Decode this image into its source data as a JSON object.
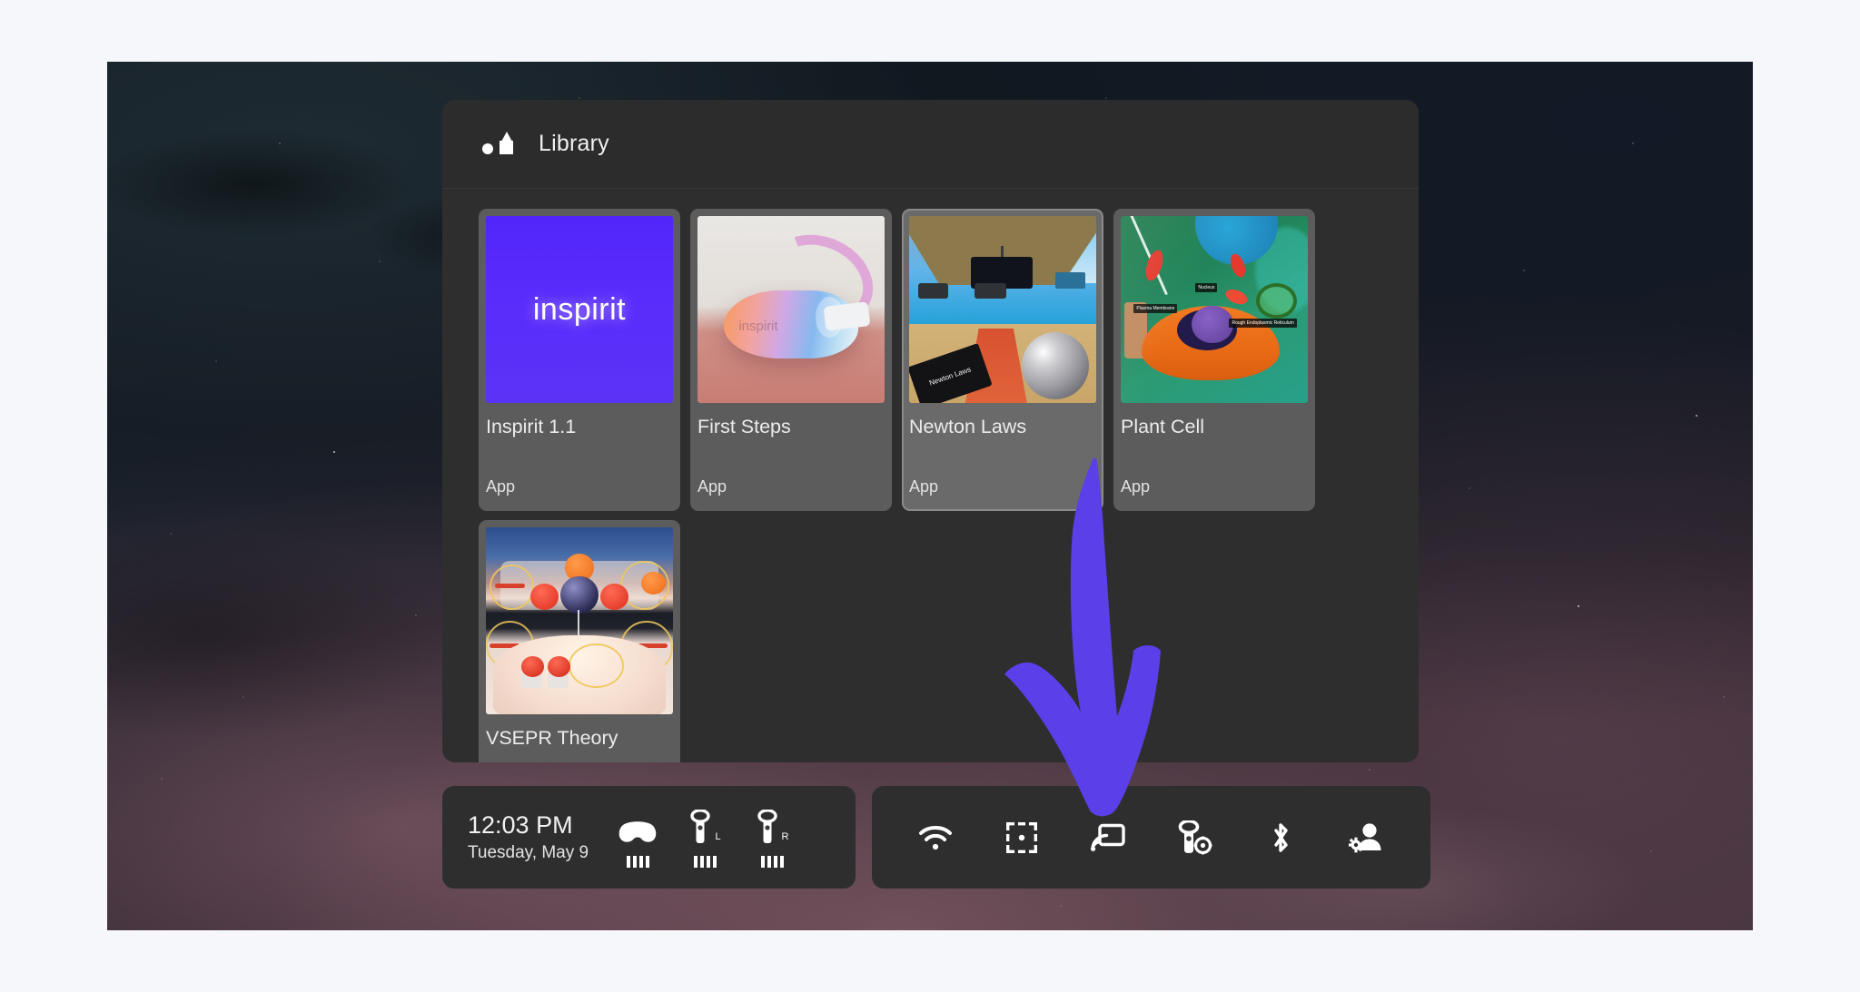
{
  "library": {
    "icon": "shapes-icon",
    "title": "Library",
    "apps": [
      {
        "name": "Inspirit 1.1",
        "kind": "App",
        "thumb": "inspirit-logo-tile",
        "logo_text": "inspirit",
        "highlighted": false
      },
      {
        "name": "First Steps",
        "kind": "App",
        "thumb": "vr-headset-photo",
        "logo_text": "inspirit",
        "highlighted": false
      },
      {
        "name": "Newton Laws",
        "kind": "App",
        "thumb": "newton-laws-scene",
        "logo_text": "Newton Laws",
        "highlighted": true
      },
      {
        "name": "Plant Cell",
        "kind": "App",
        "thumb": "plant-cell-scene",
        "labels": [
          "Nucleus",
          "Plasma Membrane",
          "Rough Endoplasmic Reticulum"
        ],
        "highlighted": false
      },
      {
        "name": "VSEPR Theory",
        "kind": "",
        "thumb": "vsepr-molecule-scene",
        "highlighted": false
      }
    ]
  },
  "taskbar": {
    "clock": {
      "time": "12:03 PM",
      "date": "Tuesday, May 9"
    },
    "devices": [
      {
        "name": "headset",
        "icon": "headset-icon",
        "label": "",
        "battery_bars": 4
      },
      {
        "name": "left-controller",
        "icon": "controller-icon",
        "label": "L",
        "battery_bars": 4
      },
      {
        "name": "right-controller",
        "icon": "controller-icon",
        "label": "R",
        "battery_bars": 4
      }
    ],
    "quick_actions": [
      {
        "name": "wifi",
        "icon": "wifi-icon"
      },
      {
        "name": "guardian",
        "icon": "guardian-boundary-icon"
      },
      {
        "name": "cast",
        "icon": "cast-icon"
      },
      {
        "name": "controller-settings",
        "icon": "controller-settings-icon"
      },
      {
        "name": "bluetooth",
        "icon": "bluetooth-icon"
      },
      {
        "name": "account-settings",
        "icon": "account-settings-icon"
      }
    ]
  },
  "annotation": {
    "arrow": {
      "name": "pointer-arrow",
      "color": "#5B3FE8",
      "points_to": "cast"
    }
  },
  "theme": {
    "page_bg": "#f6f7fb",
    "panel_bg": "#2e2e2e",
    "card_bg": "#5c5c5c",
    "card_highlight_bg": "#6a6a6a",
    "accent_purple": "#5226FA",
    "text_primary": "#f1f1f1"
  }
}
